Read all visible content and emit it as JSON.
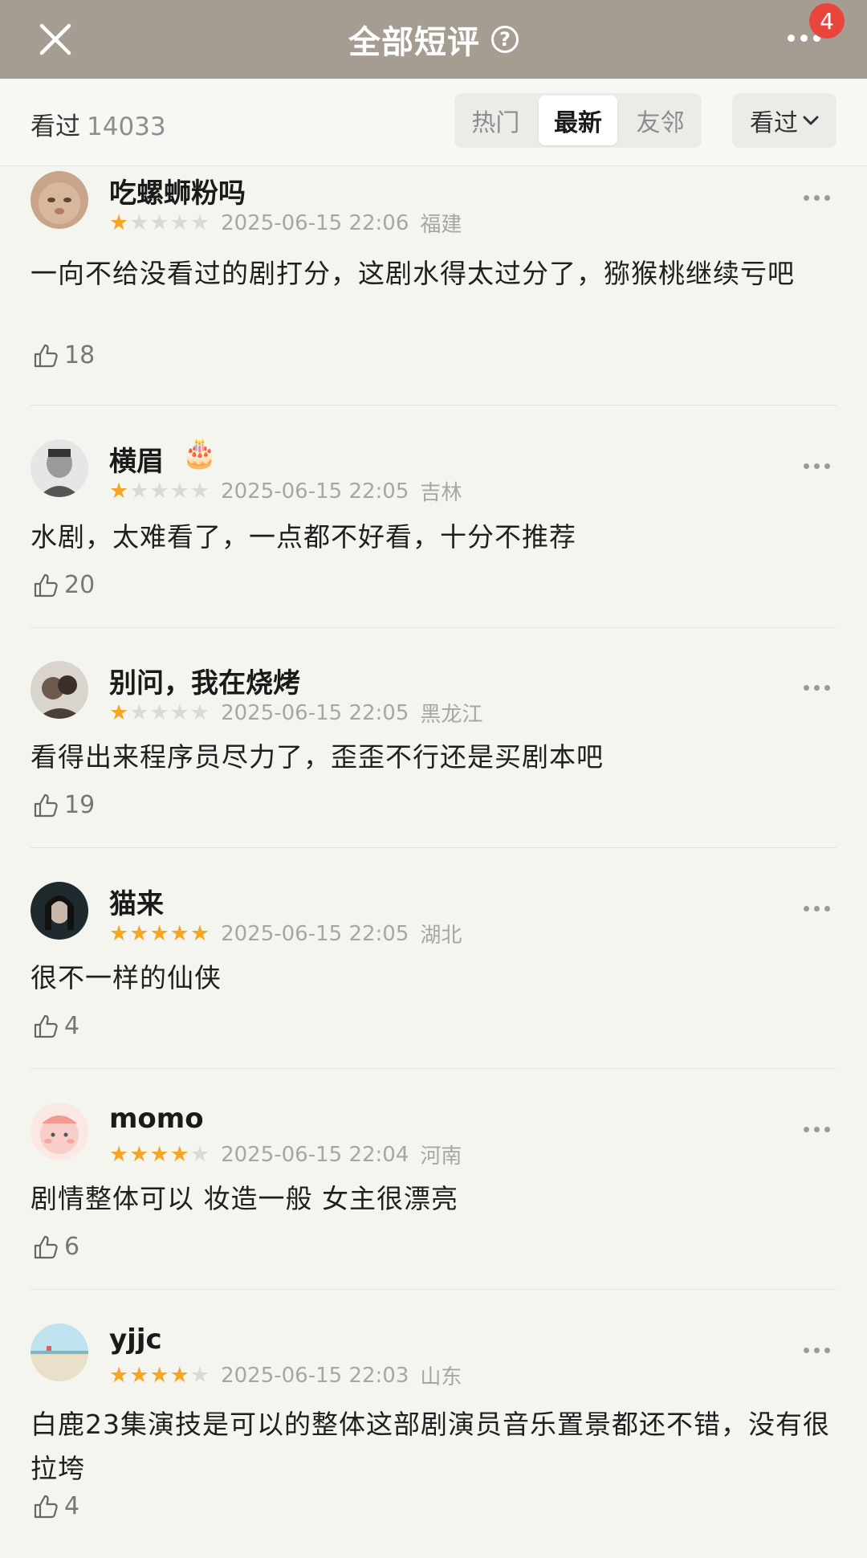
{
  "header": {
    "title": "全部短评",
    "badge": "4"
  },
  "filter": {
    "watched_label": "看过",
    "watched_count": "14033",
    "tabs": [
      {
        "label": "热门"
      },
      {
        "label": "最新"
      },
      {
        "label": "友邻"
      }
    ],
    "dropdown_label": "看过"
  },
  "comments": [
    {
      "user": "吃螺蛳粉吗",
      "rating": 1,
      "date": "2025-06-15 22:06",
      "region": "福建",
      "text": "一向不给没看过的剧打分，这剧水得太过分了，猕猴桃继续亏吧",
      "likes": "18"
    },
    {
      "user": "横眉",
      "rating": 1,
      "date": "2025-06-15 22:05",
      "region": "吉林",
      "text": "水剧，太难看了，一点都不好看，十分不推荐",
      "likes": "20"
    },
    {
      "user": "别问，我在烧烤",
      "rating": 1,
      "date": "2025-06-15 22:05",
      "region": "黑龙江",
      "text": "看得出来程序员尽力了，歪歪不行还是买剧本吧",
      "likes": "19"
    },
    {
      "user": "猫来",
      "rating": 5,
      "date": "2025-06-15 22:05",
      "region": "湖北",
      "text": "很不一样的仙侠",
      "likes": "4"
    },
    {
      "user": "momo",
      "rating": 4,
      "date": "2025-06-15 22:04",
      "region": "河南",
      "text": "剧情整体可以 妆造一般 女主很漂亮",
      "likes": "6"
    },
    {
      "user": "yjjc",
      "rating": 4,
      "date": "2025-06-15 22:03",
      "region": "山东",
      "text": "白鹿23集演技是可以的整体这部剧演员音乐置景都还不错，没有很拉垮",
      "likes": "4"
    }
  ],
  "colors": {
    "topbar": "#a59d92",
    "star": "#f5a623",
    "badge": "#e8453c"
  }
}
